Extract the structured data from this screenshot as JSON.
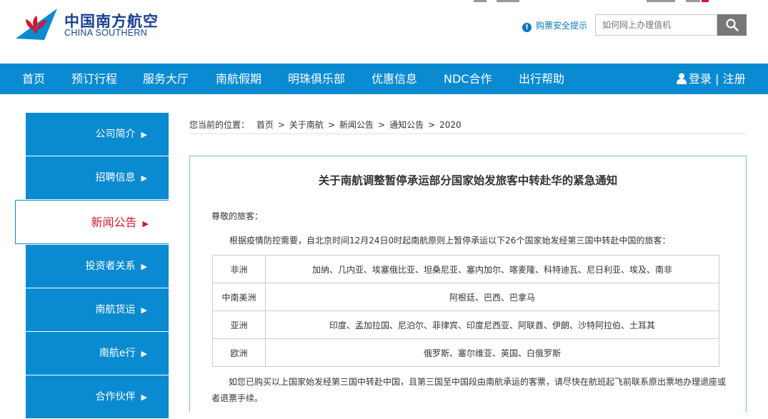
{
  "brand": {
    "name_cn": "中国南方航空",
    "name_en": "CHINA SOUTHERN"
  },
  "header": {
    "safety_tip": "购票安全提示"
  },
  "search": {
    "placeholder": "如何网上办理值机"
  },
  "nav": {
    "items": [
      "首页",
      "预订行程",
      "服务大厅",
      "南航假期",
      "明珠俱乐部",
      "优惠信息",
      "NDC合作",
      "出行帮助"
    ],
    "login": "登录 | 注册"
  },
  "sidebar": {
    "items": [
      "公司简介",
      "招聘信息",
      "新闻公告",
      "投资者关系",
      "南航货运",
      "南航e行",
      "合作伙伴"
    ],
    "active": "新闻公告"
  },
  "breadcrumb": {
    "prefix": "您当前的位置：",
    "items": [
      "首页",
      "关于南航",
      "新闻公告",
      "通知公告",
      "2020"
    ]
  },
  "article": {
    "title": "关于南航调整暂停承运部分国家始发旅客中转赴华的紧急通知",
    "greeting": "尊敬的旅客：",
    "para1": "根据疫情防控需要，自北京时间12月24日0时起南航原则上暂停承运以下26个国家始发经第三国中转赴中国的旅客：",
    "table": [
      {
        "region": "非洲",
        "countries": "加纳、几内亚、埃塞俄比亚、坦桑尼亚、塞内加尔、喀麦隆、科特迪瓦、尼日利亚、埃及、南非"
      },
      {
        "region": "中南美洲",
        "countries": "阿根廷、巴西、巴拿马"
      },
      {
        "region": "亚洲",
        "countries": "印度、孟加拉国、尼泊尔、菲律宾、印度尼西亚、阿联酋、伊朗、沙特阿拉伯、土耳其"
      },
      {
        "region": "欧洲",
        "countries": "俄罗斯、塞尔维亚、英国、白俄罗斯"
      }
    ],
    "para2": "如您已购买以上国家始发经第三国中转赴中国，且第三国至中国段由南航承运的客票，请尽快在航班起飞前联系原出票地办理退座或者退票手续。"
  },
  "colors": {
    "primary_blue": "#0a8ad1",
    "active_red": "#d7142b",
    "brand_navy": "#1b3f8f"
  }
}
